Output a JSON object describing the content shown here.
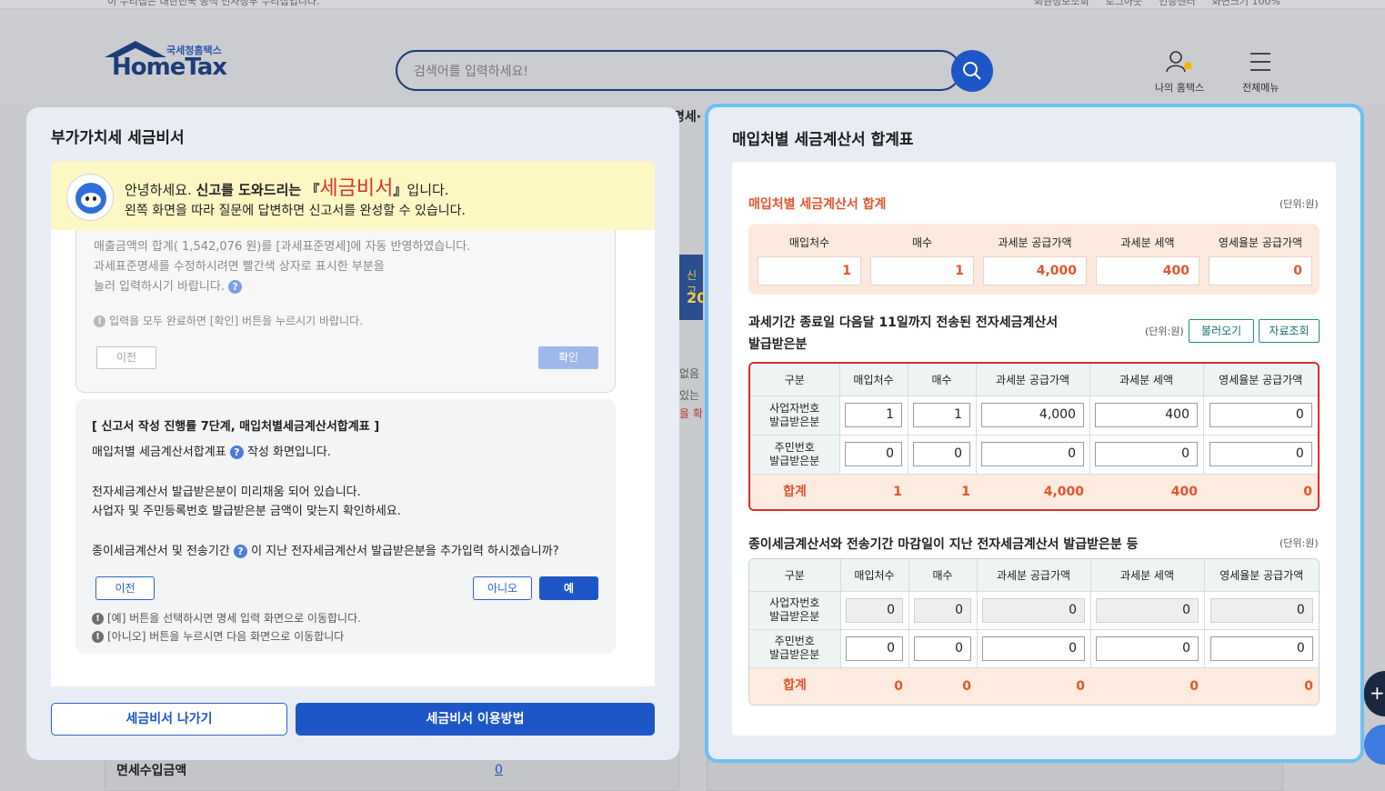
{
  "background": {
    "topbar_notice": "이 누리집은 대한민국 공식 전자정부 누리집입니다.",
    "topbar_links": [
      "회원정보조회",
      "로그아웃",
      "인증센터",
      "화면크기 100%"
    ],
    "logo_sub": "국세청홈택스",
    "logo_main": "HomeTax",
    "search_placeholder": "검색어를 입력하세요!",
    "my_hometax_label": "나의 홈택스",
    "all_menu_label": "전체메뉴",
    "nav_fragment": "명세·",
    "strip_small": "신고",
    "strip_big": "20",
    "side_texts": [
      "없음",
      "있는",
      "을 확"
    ],
    "bottom_row_label": "면세수입금액",
    "bottom_row_value": "0"
  },
  "left_modal": {
    "title": "부가가치세 세금비서",
    "greeting": {
      "prefix": "안녕하세요. ",
      "bold": "신고를 도와드리는 ",
      "brand_open": "『",
      "brand": "세금비서",
      "brand_close": "』",
      "suffix": "입니다.",
      "line2": "왼쪽 화면을 따라 질문에 답변하면 신고서를 완성할 수 있습니다."
    },
    "prev_card": {
      "line1": "매출금액의 합계( 1,542,076 원)를 [과세표준명세]에 자동 반영하였습니다.",
      "line2": "과세표준명세를 수정하시려면 빨간색 상자로 표시한 부분을",
      "line3": "눌러 입력하시기 바랍니다.",
      "notice": "입력을 모두 완료하면 [확인] 버튼을 누르시기 바랍니다.",
      "prev_btn": "이전",
      "confirm_btn": "확인"
    },
    "current_card": {
      "heading": "[ 신고서 작성 진행률 7단계, 매입처별세금계산서합계표 ]",
      "line1a": "매입처별 세금계산서합계표",
      "line1b": "작성 화면입니다.",
      "line2": "전자세금계산서 발급받은분이 미리채움 되어 있습니다.",
      "line3": "사업자 및 주민등록번호 발급받은분 금액이 맞는지 확인하세요.",
      "line4a": "종이세금계산서 및 전송기간",
      "line4b": "이 지난 전자세금계산서 발급받은분을 추가입력 하시겠습니까?",
      "prev_btn": "이전",
      "no_btn": "아니오",
      "yes_btn": "예",
      "note1": "[예] 버튼을 선택하시면 명세 입력 화면으로 이동합니다.",
      "note2": "[아니오] 버튼을 누르시면 다음 화면으로 이동합니다"
    },
    "help_glyph": "?",
    "warn_glyph": "!",
    "exit_btn": "세금비서 나가기",
    "howto_btn": "세금비서 이용방법"
  },
  "right_modal": {
    "title": "매입처별 세금계산서 합계표",
    "unit_label": "(단위:원)",
    "summary": {
      "title": "매입처별 세금계산서 합계",
      "headers": [
        "매입처수",
        "매수",
        "과세분 공급가액",
        "과세분 세액",
        "영세율분 공급가액"
      ],
      "values": [
        "1",
        "1",
        "4,000",
        "400",
        "0"
      ]
    },
    "electronic": {
      "title_line1": "과세기간 종료일 다음달 11일까지 전송된 전자세금계산서",
      "title_line2": "발급받은분",
      "load_btn": "불러오기",
      "lookup_btn": "자료조회",
      "headers": [
        "구분",
        "매입처수",
        "매수",
        "과세분 공급가액",
        "과세분 세액",
        "영세율분 공급가액"
      ],
      "rows": [
        {
          "label1": "사업자번호",
          "label2": "발급받은분",
          "values": [
            "1",
            "1",
            "4,000",
            "400",
            "0"
          ]
        },
        {
          "label1": "주민번호",
          "label2": "발급받은분",
          "values": [
            "0",
            "0",
            "0",
            "0",
            "0"
          ]
        }
      ],
      "total": {
        "label": "합계",
        "values": [
          "1",
          "1",
          "4,000",
          "400",
          "0"
        ]
      }
    },
    "paper": {
      "title": "종이세금계산서와 전송기간 마감일이 지난 전자세금계산서 발급받은분 등",
      "headers": [
        "구분",
        "매입처수",
        "매수",
        "과세분 공급가액",
        "과세분 세액",
        "영세율분 공급가액"
      ],
      "rows": [
        {
          "label1": "사업자번호",
          "label2": "발급받은분",
          "values": [
            "0",
            "0",
            "0",
            "0",
            "0"
          ]
        },
        {
          "label1": "주민번호",
          "label2": "발급받은분",
          "values": [
            "0",
            "0",
            "0",
            "0",
            "0"
          ]
        }
      ],
      "total": {
        "label": "합계",
        "values": [
          "0",
          "0",
          "0",
          "0",
          "0"
        ]
      }
    }
  },
  "float_plus": "+",
  "colors": {
    "primary": "#1d56c6",
    "accent_orange": "#e3552c",
    "alert_red": "#dc2b2b",
    "focus_border": "#6ec0f2"
  }
}
